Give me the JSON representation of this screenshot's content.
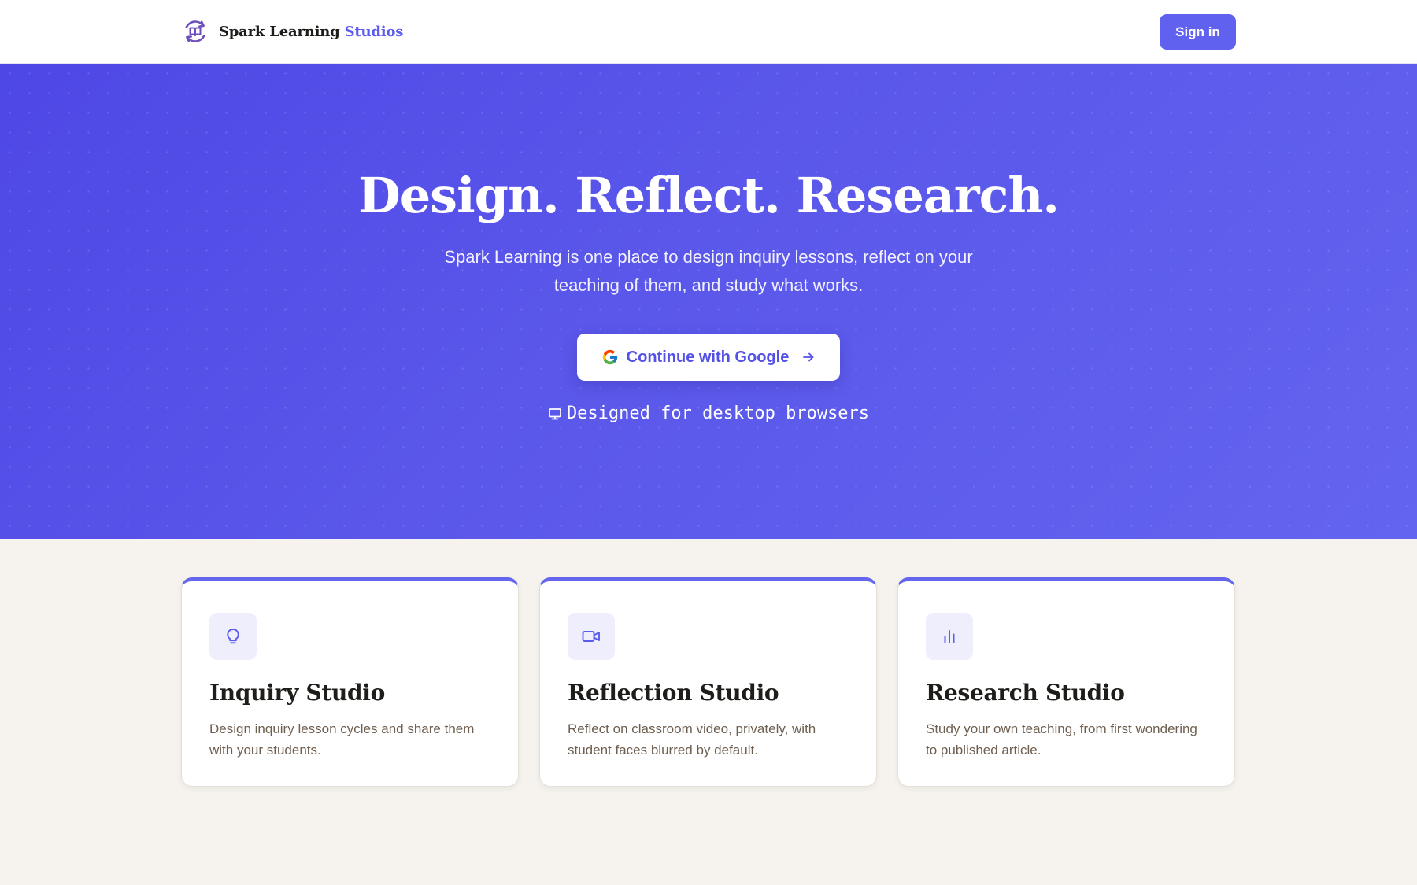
{
  "header": {
    "brand_name": "Spark Learning",
    "brand_accent": "Studios",
    "logo_icon": "book-cycle-icon",
    "signin_label": "Sign in"
  },
  "hero": {
    "title": "Design. Reflect. Research.",
    "subtitle": "Spark Learning is one place to design inquiry lessons, reflect on your teaching of them, and study what works.",
    "cta_label": "Continue with Google",
    "cta_icon": "google-icon",
    "cta_arrow_icon": "arrow-right-icon",
    "note_icon": "monitor-icon",
    "note": "Designed for desktop browsers"
  },
  "cards": [
    {
      "icon": "lightbulb-icon",
      "title": "Inquiry Studio",
      "description": "Design inquiry lesson cycles and share them with your students."
    },
    {
      "icon": "video-camera-icon",
      "title": "Reflection Studio",
      "description": "Reflect on classroom video, privately, with student faces blurred by default."
    },
    {
      "icon": "bar-chart-icon",
      "title": "Research Studio",
      "description": "Study your own teaching, from first wondering to published article."
    }
  ],
  "colors": {
    "accent": "#6061ef",
    "hero_background": "#5a57ea",
    "page_background": "#f6f3ee",
    "card_icon_background": "#eeeefd",
    "heading_text": "#1f1d1a",
    "body_text": "#6e5f50"
  }
}
